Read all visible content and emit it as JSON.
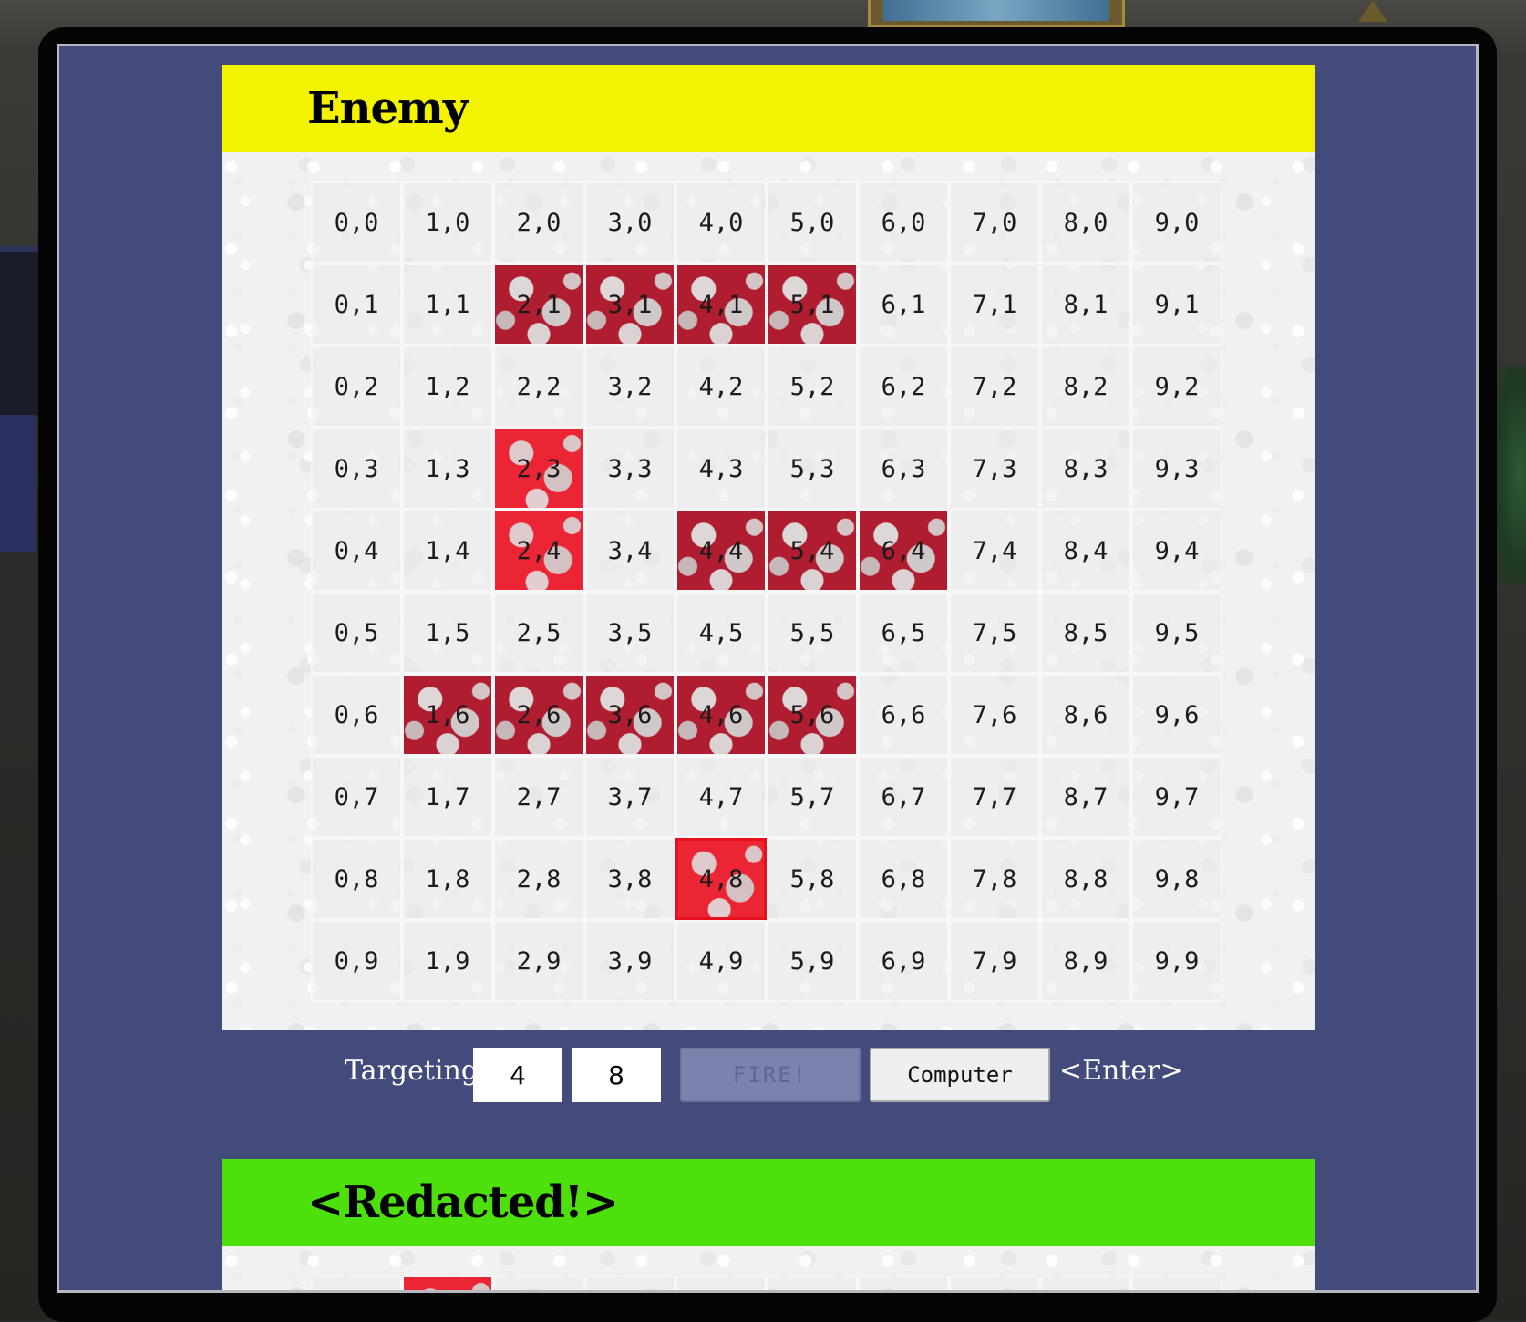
{
  "enemy_board": {
    "title": "Enemy",
    "cells": [
      [
        "0,0",
        "1,0",
        "2,0",
        "3,0",
        "4,0",
        "5,0",
        "6,0",
        "7,0",
        "8,0",
        "9,0"
      ],
      [
        "0,1",
        "1,1",
        "2,1",
        "3,1",
        "4,1",
        "5,1",
        "6,1",
        "7,1",
        "8,1",
        "9,1"
      ],
      [
        "0,2",
        "1,2",
        "2,2",
        "3,2",
        "4,2",
        "5,2",
        "6,2",
        "7,2",
        "8,2",
        "9,2"
      ],
      [
        "0,3",
        "1,3",
        "2,3",
        "3,3",
        "4,3",
        "5,3",
        "6,3",
        "7,3",
        "8,3",
        "9,3"
      ],
      [
        "0,4",
        "1,4",
        "2,4",
        "3,4",
        "4,4",
        "5,4",
        "6,4",
        "7,4",
        "8,4",
        "9,4"
      ],
      [
        "0,5",
        "1,5",
        "2,5",
        "3,5",
        "4,5",
        "5,5",
        "6,5",
        "7,5",
        "8,5",
        "9,5"
      ],
      [
        "0,6",
        "1,6",
        "2,6",
        "3,6",
        "4,6",
        "5,6",
        "6,6",
        "7,6",
        "8,6",
        "9,6"
      ],
      [
        "0,7",
        "1,7",
        "2,7",
        "3,7",
        "4,7",
        "5,7",
        "6,7",
        "7,7",
        "8,7",
        "9,7"
      ],
      [
        "0,8",
        "1,8",
        "2,8",
        "3,8",
        "4,8",
        "5,8",
        "6,8",
        "7,8",
        "8,8",
        "9,8"
      ],
      [
        "0,9",
        "1,9",
        "2,9",
        "3,9",
        "4,9",
        "5,9",
        "6,9",
        "7,9",
        "8,9",
        "9,9"
      ]
    ],
    "sunk": [
      "2,1",
      "3,1",
      "4,1",
      "5,1",
      "4,4",
      "5,4",
      "6,4",
      "1,6",
      "2,6",
      "3,6",
      "4,6",
      "5,6"
    ],
    "hit": [
      "2,3",
      "2,4",
      "4,8"
    ],
    "targeted": "4,8",
    "colors": {
      "header": "#f3f300",
      "sunk": "#b01c30",
      "hit": "#ec2535",
      "target_outline": "#e8101c"
    }
  },
  "targeting": {
    "label": "Targeting:",
    "x_value": "4",
    "y_value": "8",
    "fire_label": "FIRE!",
    "computer_label": "Computer",
    "hint": "<Enter>"
  },
  "player_board": {
    "title": "<Redacted!>",
    "colors": {
      "header": "#4ee00c"
    },
    "visible_hit_columns": [
      1
    ]
  },
  "colors": {
    "screen_background": "#434a7c"
  }
}
